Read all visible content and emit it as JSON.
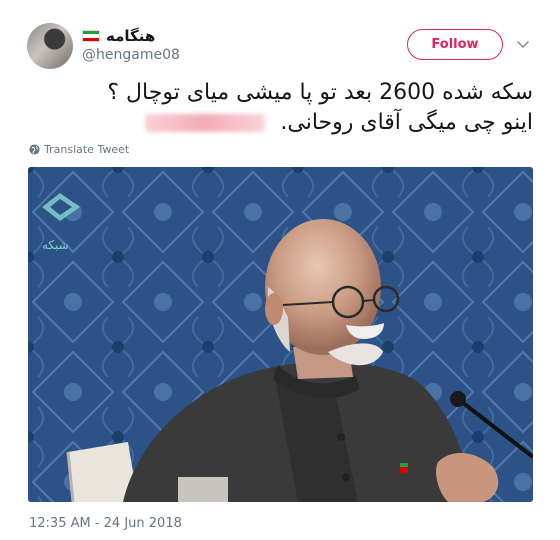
{
  "user": {
    "display_name": "هنگامه",
    "handle": "@hengame08",
    "flag_colors": [
      "#239f40",
      "#ffffff",
      "#da0000"
    ]
  },
  "follow": {
    "label": "Follow",
    "color": "#e0245e"
  },
  "tweet": {
    "line1": "سکه شده 2600 بعد تو پا میشی میای توچال ؟",
    "line2_pre": "",
    "line2_post": "اینو چی میگی آقای روحانی."
  },
  "translate": {
    "label": "Translate Tweet",
    "icon": "globe-icon"
  },
  "media": {
    "channel_logo_text": "شبکه",
    "background_color": "#2b4f83"
  },
  "timestamp": "12:35 AM - 24 Jun 2018",
  "colors": {
    "secondary_text": "#657786",
    "primary_text": "#14171a"
  }
}
